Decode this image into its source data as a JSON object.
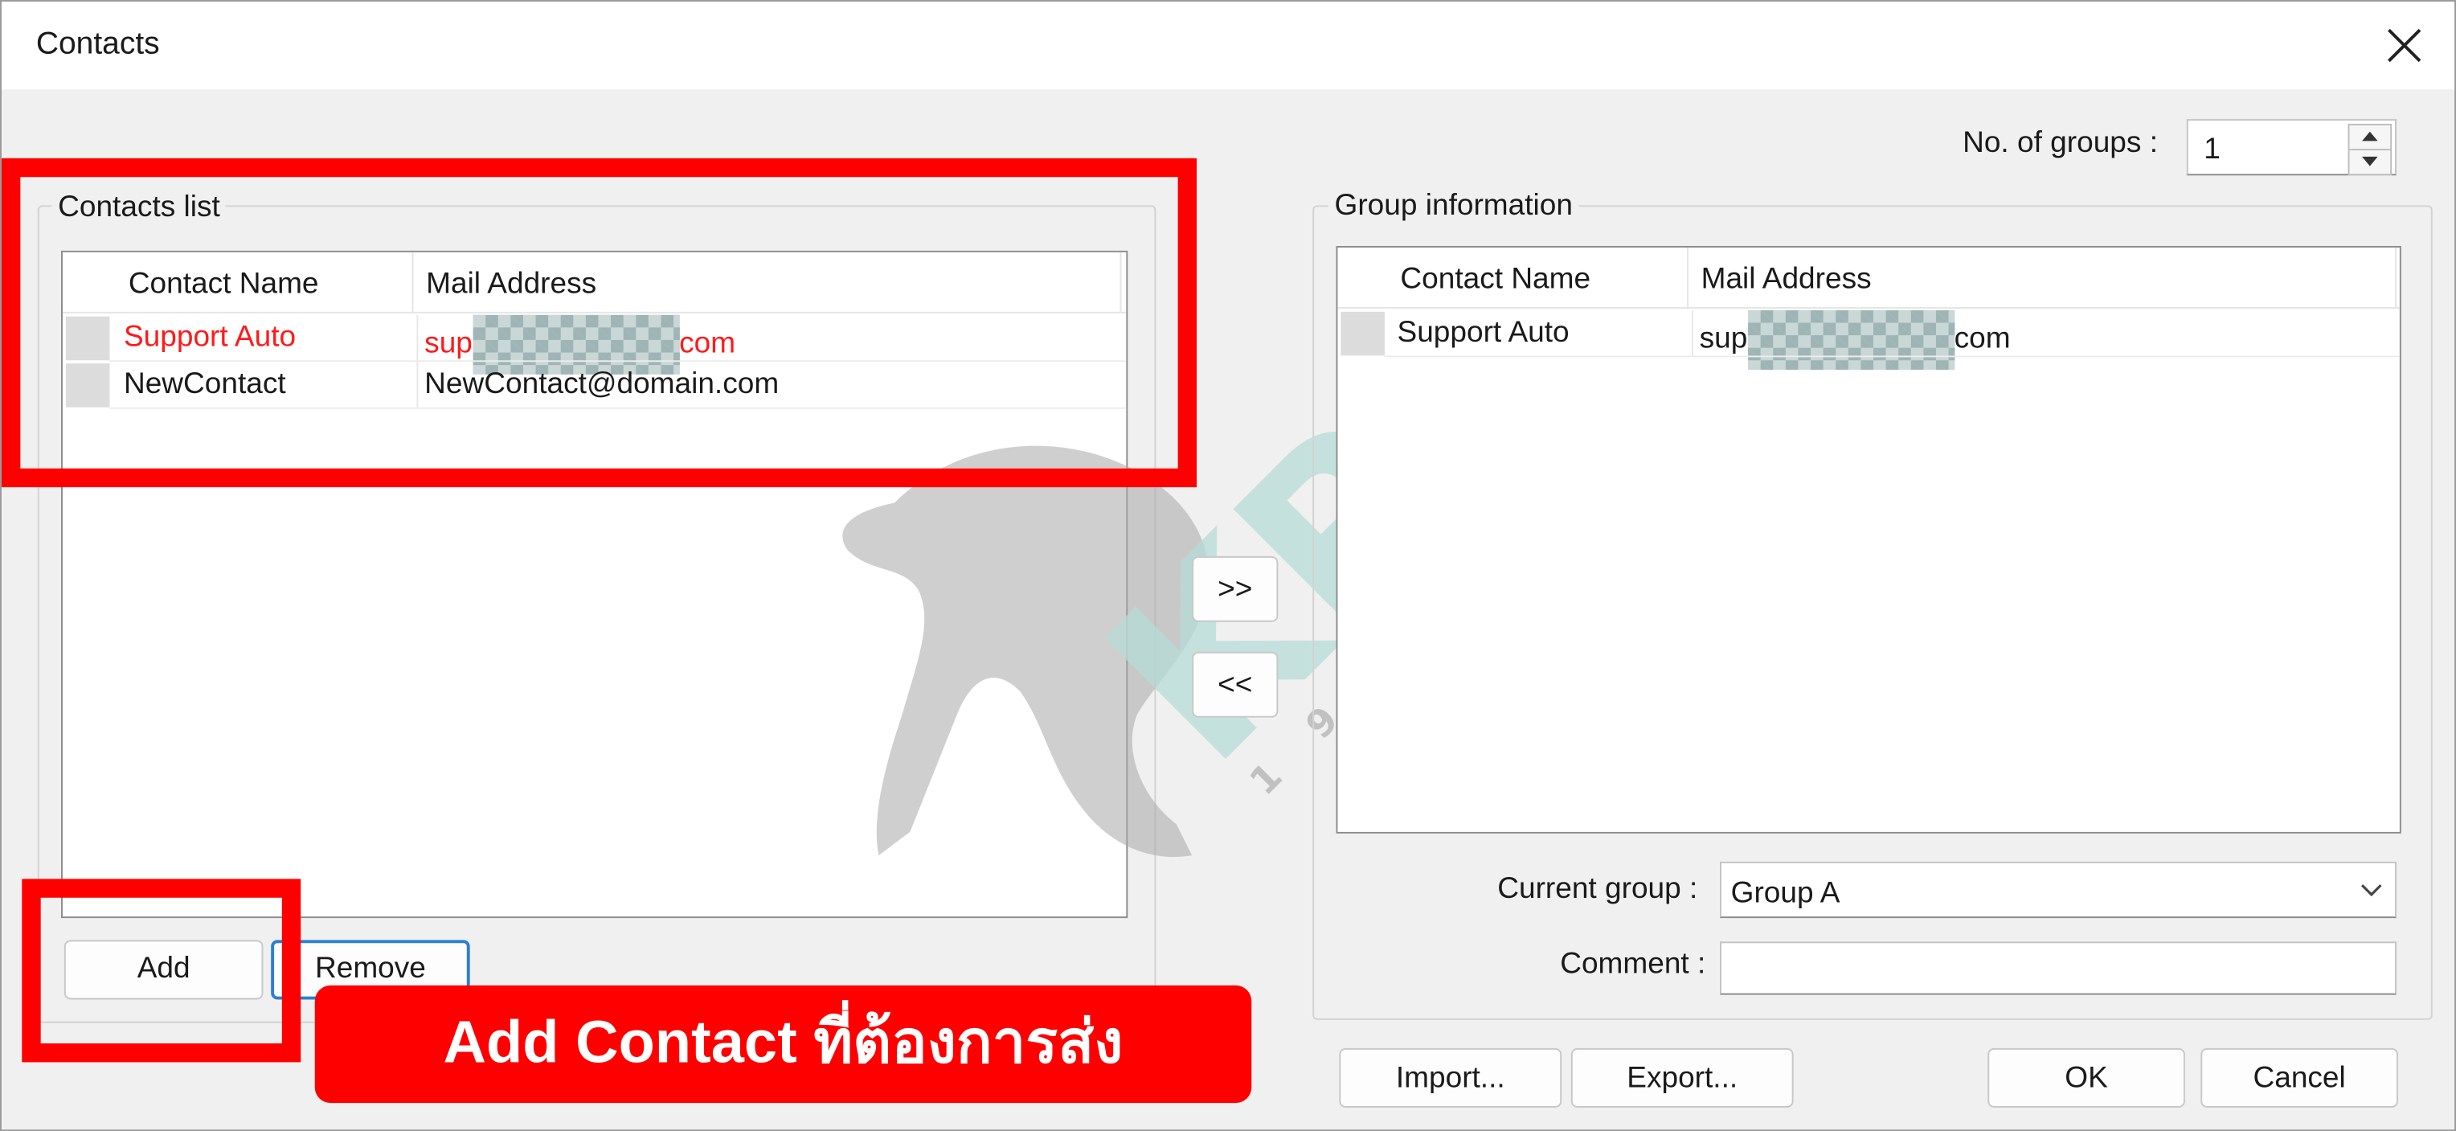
{
  "window": {
    "title": "Contacts"
  },
  "groups_count": {
    "label": "No. of groups :",
    "value": "1"
  },
  "contacts_list": {
    "legend": "Contacts list",
    "columns": [
      "Contact Name",
      "Mail Address"
    ],
    "rows": [
      {
        "name": "Support Auto",
        "mail_prefix": "sup",
        "mail_suffix": "com",
        "selected": true
      },
      {
        "name": "NewContact",
        "mail": "NewContact@domain.com"
      }
    ],
    "add_label": "Add",
    "remove_label": "Remove"
  },
  "transfer": {
    "move_right": ">>",
    "move_left": "<<"
  },
  "group_info": {
    "legend": "Group information",
    "columns": [
      "Contact Name",
      "Mail Address"
    ],
    "rows": [
      {
        "name": "Support Auto",
        "mail_prefix": "sup",
        "mail_suffix": "com"
      }
    ],
    "current_group_label": "Current group :",
    "current_group_value": "Group A",
    "comment_label": "Comment :",
    "comment_value": ""
  },
  "footer": {
    "import_label": "Import...",
    "export_label": "Export...",
    "ok_label": "OK",
    "cancel_label": "Cancel"
  },
  "annotation": {
    "banner_text": "Add Contact ที่ต้องการส่ง",
    "highlight_color": "#ff0000"
  },
  "watermark": {
    "logo_text": "KPT",
    "year_text": "1993"
  },
  "colors": {
    "selected_text": "#ff1a1a",
    "focus_border": "#2a7fd4"
  }
}
